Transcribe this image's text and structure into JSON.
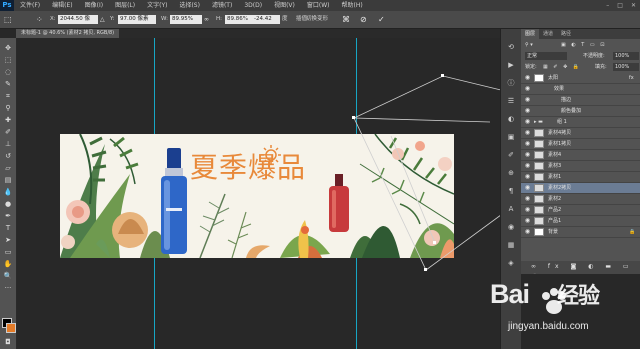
{
  "menubar": {
    "logo": "Ps",
    "items": [
      "文件(F)",
      "编辑(E)",
      "图像(I)",
      "图层(L)",
      "文字(Y)",
      "选择(S)",
      "滤镜(T)",
      "3D(D)",
      "视图(V)",
      "窗口(W)",
      "帮助(H)"
    ]
  },
  "options": {
    "x_label": "X:",
    "x_value": "2044.50 像",
    "y_label": "Y:",
    "y_value": "97.00 像素",
    "w_label": "W:",
    "w_value": "89.95%",
    "h_label": "H:",
    "h_value": "89.86%",
    "angle_value": "-24.42",
    "angle_unit": "度",
    "interp_label": "插值:",
    "warp_label": "切换变形"
  },
  "document": {
    "tab_label": "未标题-1 @ 40.6% (素材2 拷贝, RGB/8)"
  },
  "banner": {
    "headline": "夏季爆品",
    "accent": "#e8893a"
  },
  "panel": {
    "tabs": [
      "图层",
      "通道",
      "路径"
    ],
    "blend_mode": "正常",
    "opacity_label": "不透明度:",
    "opacity_value": "100%",
    "lock_label": "锁定:",
    "fill_label": "填充:",
    "fill_value": "100%",
    "layers": [
      {
        "name": "太阳",
        "selected": false,
        "indent": 0
      },
      {
        "name": "效果",
        "selected": false,
        "indent": 1
      },
      {
        "name": "描边",
        "selected": false,
        "indent": 2
      },
      {
        "name": "颜色叠加",
        "selected": false,
        "indent": 2
      },
      {
        "name": "组 1",
        "selected": false,
        "indent": 0
      },
      {
        "name": "素材4拷贝",
        "selected": false,
        "indent": 0
      },
      {
        "name": "素材1拷贝",
        "selected": false,
        "indent": 0
      },
      {
        "name": "素材4",
        "selected": false,
        "indent": 0
      },
      {
        "name": "素材3",
        "selected": false,
        "indent": 0
      },
      {
        "name": "素材1",
        "selected": false,
        "indent": 0
      },
      {
        "name": "素材2拷贝",
        "selected": true,
        "indent": 0
      },
      {
        "name": "素材2",
        "selected": false,
        "indent": 0
      },
      {
        "name": "产品2",
        "selected": false,
        "indent": 0
      },
      {
        "name": "产品1",
        "selected": false,
        "indent": 0
      },
      {
        "name": "背景",
        "selected": false,
        "indent": 0
      }
    ]
  },
  "watermark": {
    "brand": "Bai",
    "brand2": "经验",
    "url": "jingyan.baidu.com"
  }
}
